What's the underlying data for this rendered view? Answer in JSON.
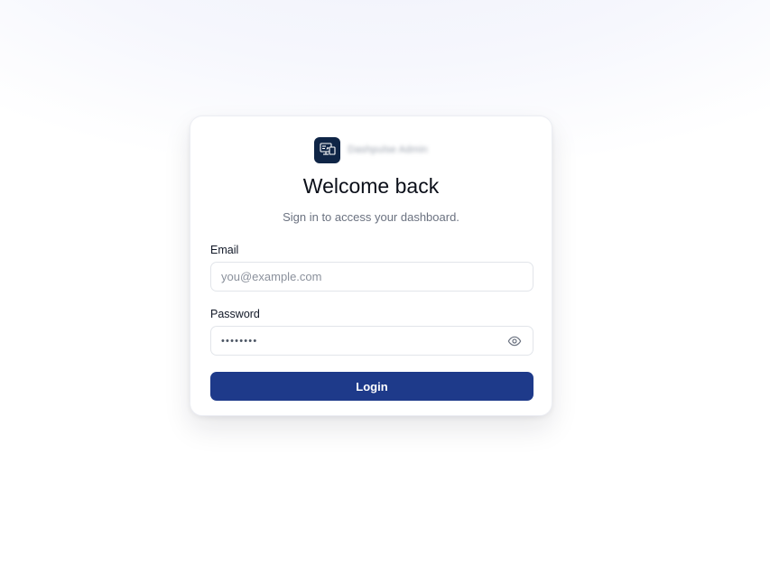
{
  "brand": {
    "logo_icon": "monitor-dashboard-icon",
    "name": "Dashpulse Admin"
  },
  "header": {
    "title": "Welcome back",
    "subtitle": "Sign in to access your dashboard."
  },
  "form": {
    "email": {
      "label": "Email",
      "placeholder": "you@example.com",
      "value": ""
    },
    "password": {
      "label": "Password",
      "masked_value": "••••••••",
      "toggle_icon": "eye-icon"
    },
    "submit_label": "Login"
  },
  "colors": {
    "primary": "#1e3a8a",
    "logo_bg": "#0f2546"
  }
}
